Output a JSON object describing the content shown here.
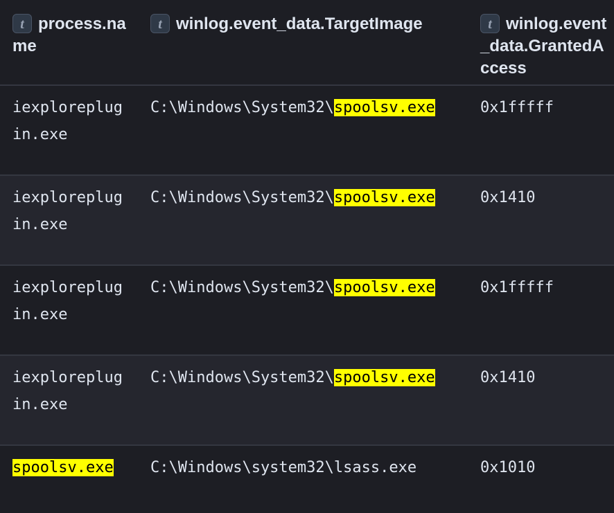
{
  "columns": [
    {
      "type_badge": "t",
      "title": "process.name"
    },
    {
      "type_badge": "t",
      "title": "winlog.event_data.TargetImage"
    },
    {
      "type_badge": "t",
      "title": "winlog.event_data.GrantedAccess"
    }
  ],
  "rows": [
    {
      "process_line1": "iexplorepl​ug",
      "process_line2": "in.exe",
      "process_highlight": "",
      "target_prefix": "C:\\Windows\\System32\\",
      "target_highlight": "spoolsv.exe",
      "access": "0x1fffff"
    },
    {
      "process_line1": "iexploreplug",
      "process_line2": "in.exe",
      "process_highlight": "",
      "target_prefix": "C:\\Windows\\System32\\",
      "target_highlight": "spoolsv.exe",
      "access": "0x1410"
    },
    {
      "process_line1": "iexploreplug",
      "process_line2": "in.exe",
      "process_highlight": "",
      "target_prefix": "C:\\Windows\\System32\\",
      "target_highlight": "spoolsv.exe",
      "access": "0x1fffff"
    },
    {
      "process_line1": "iexploreplug",
      "process_line2": "in.exe",
      "process_highlight": "",
      "target_prefix": "C:\\Windows\\System32\\",
      "target_highlight": "spoolsv.exe",
      "access": "0x1410"
    },
    {
      "process_line1": "",
      "process_line2": "",
      "process_highlight": "spoolsv.exe",
      "target_prefix": "C:\\Windows\\system32\\lsass.exe",
      "target_highlight": "",
      "access": "0x1010"
    }
  ],
  "colors": {
    "background": "#1d1e24",
    "row_alt": "#25262e",
    "divider": "#343741",
    "highlight": "#ffff00",
    "text": "#dfe5ef"
  }
}
